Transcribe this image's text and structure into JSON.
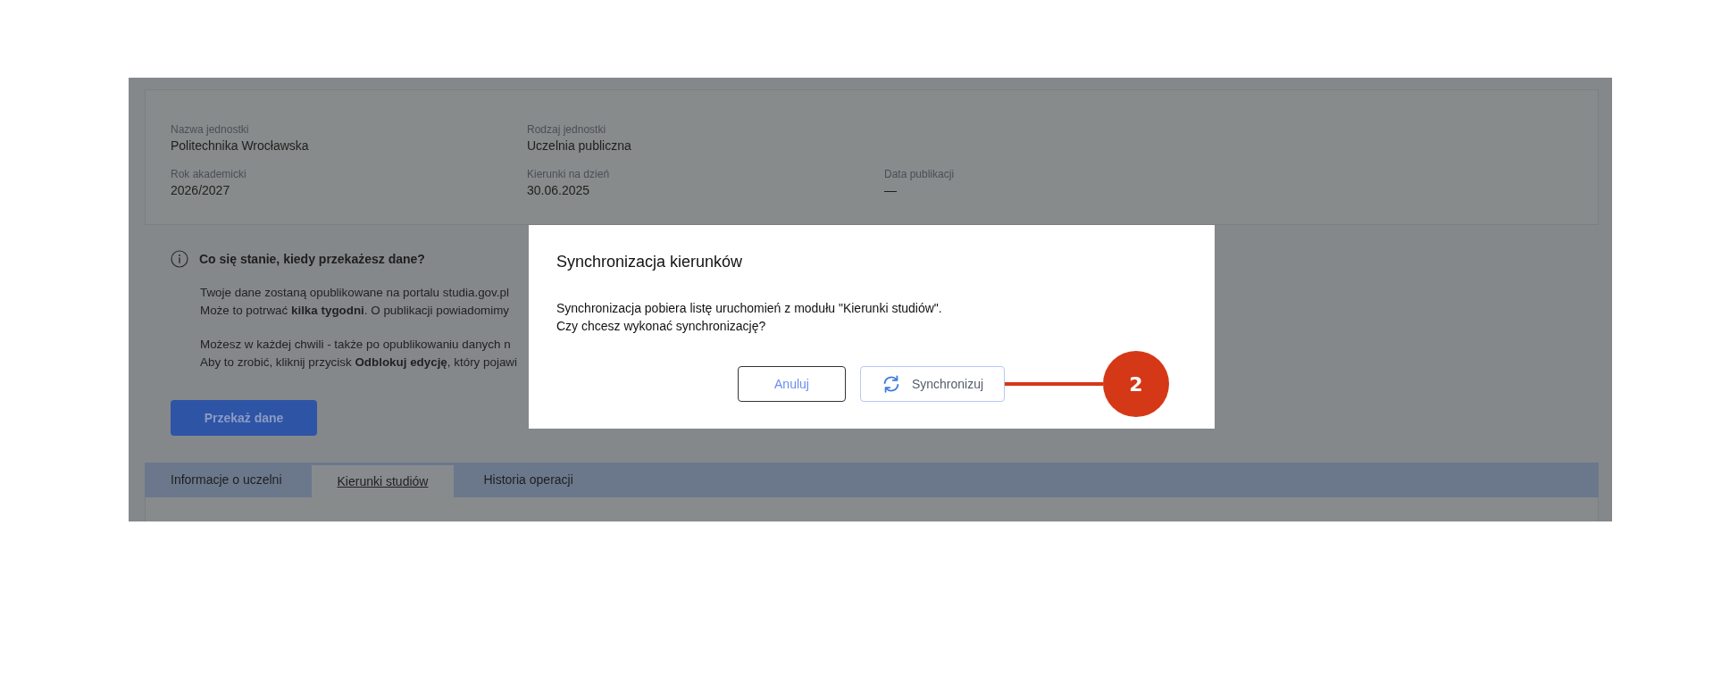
{
  "unit_details": {
    "fields": [
      {
        "label": "Nazwa jednostki",
        "value": "Politechnika Wrocławska"
      },
      {
        "label": "Rodzaj jednostki",
        "value": "Uczelnia publiczna"
      },
      {
        "label": "Rok akademicki",
        "value": "2026/2027"
      },
      {
        "label": "Kierunki na dzień",
        "value": "30.06.2025"
      },
      {
        "label": "Data publikacji",
        "value": "—"
      }
    ]
  },
  "info": {
    "heading": "Co się stanie, kiedy przekażesz dane?",
    "paragraphs": [
      [
        "Twoje dane zostaną opublikowane na portalu studia.gov.pl",
        "Może to potrwać **kilka tygodni**. O publikacji powiadomimy"
      ],
      [
        "Możesz w każdej chwili - także po opublikowaniu danych n",
        "Aby to zrobić, kliknij przycisk **Odblokuj edycję**, który pojawi"
      ]
    ]
  },
  "submit_button": "Przekaż dane",
  "tabs": [
    {
      "label": "Informacje o uczelni",
      "selected": false
    },
    {
      "label": "Kierunki studiów",
      "selected": true
    },
    {
      "label": "Historia operacji",
      "selected": false
    }
  ],
  "dialog": {
    "title": "Synchronizacja kierunków",
    "message": [
      "Synchronizacja pobiera listę uruchomień z modułu \"Kierunki studiów\".",
      "Czy chcesz wykonać synchronizację?"
    ],
    "buttons": [
      {
        "label": "Anuluj",
        "kind": "cancel"
      },
      {
        "label": "Synchronizuj",
        "kind": "sync"
      }
    ]
  },
  "callout": {
    "number": "2"
  }
}
